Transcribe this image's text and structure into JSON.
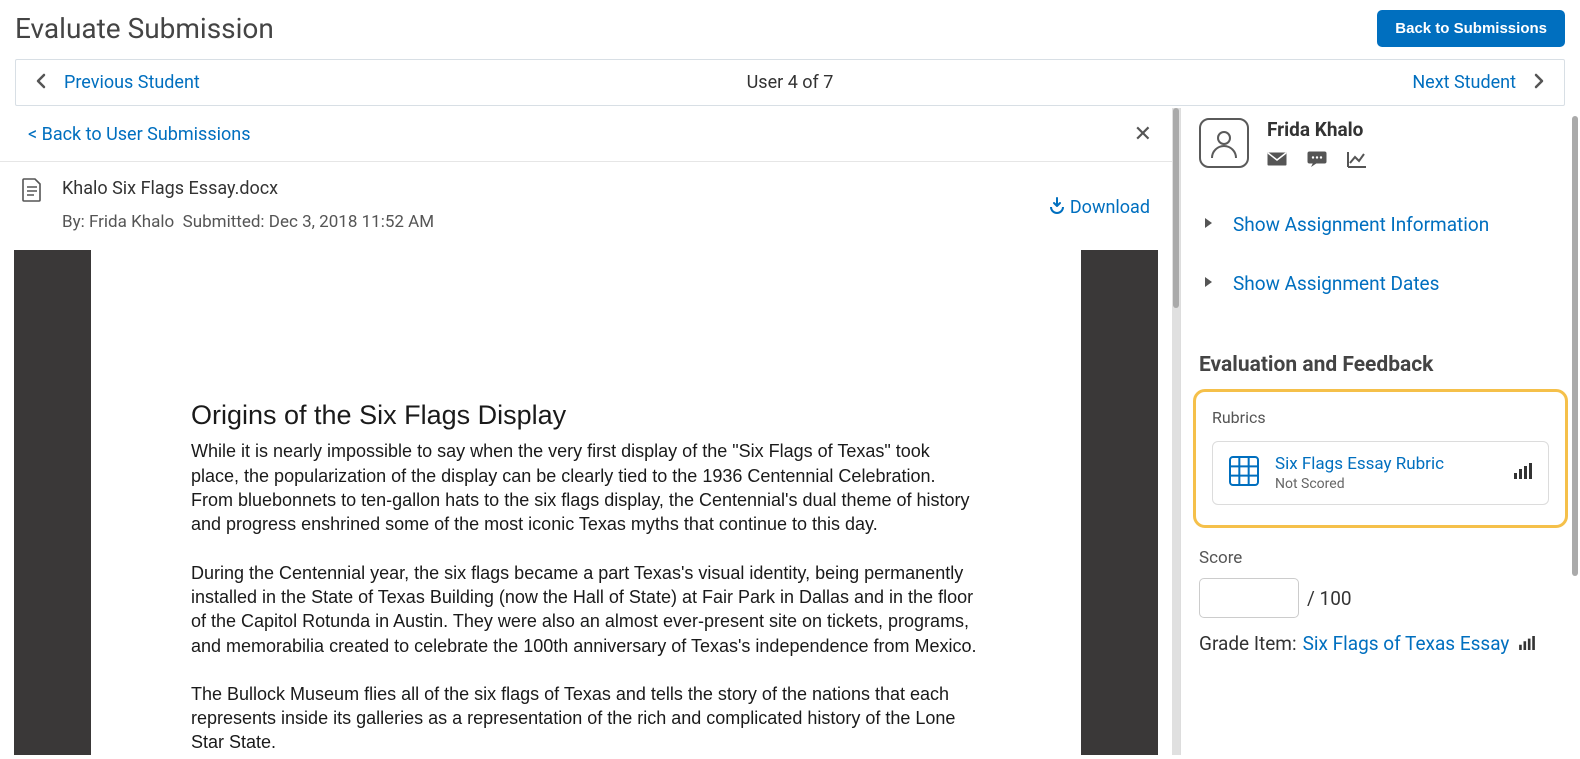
{
  "header": {
    "title": "Evaluate Submission",
    "back_button": "Back to Submissions"
  },
  "nav": {
    "prev": "Previous Student",
    "position": "User 4 of 7",
    "next": "Next Student"
  },
  "back_link": "< Back to User Submissions",
  "file": {
    "name": "Khalo Six Flags Essay.docx",
    "by_label": "By:",
    "author": "Frida Khalo",
    "submitted_label": "Submitted:",
    "submitted_at": "Dec 3, 2018 11:52 AM",
    "download": "Download"
  },
  "document": {
    "heading": "Origins of the Six Flags Display",
    "p1": "While it is nearly impossible to say when the very first display of the \"Six Flags of Texas\" took place, the popularization of the display can be clearly tied to the 1936 Centennial Celebration. From bluebonnets to ten-gallon hats to the six flags display, the Centennial's dual theme of history and progress enshrined some of the most iconic Texas myths that continue to this day.",
    "p2": "During the Centennial year, the six flags became a part Texas's visual identity, being permanently installed in the State of Texas Building (now the Hall of State) at Fair Park in Dallas and in the floor of the Capitol Rotunda in Austin. They were also an almost ever-present site on tickets, programs, and memorabilia created to celebrate the 100th anniversary of Texas's independence from Mexico.",
    "p3": "The Bullock Museum flies all of the six flags of Texas and tells the story of the nations that each represents inside its galleries as a representation of the rich and complicated history of the Lone Star State."
  },
  "sidebar": {
    "student_name": "Frida Khalo",
    "show_info": "Show Assignment Information",
    "show_dates": "Show Assignment Dates",
    "eval_heading": "Evaluation and Feedback",
    "rubrics_label": "Rubrics",
    "rubric_name": "Six Flags Essay Rubric",
    "rubric_status": "Not Scored",
    "score_label": "Score",
    "score_max": "/ 100",
    "grade_item_label": "Grade Item:",
    "grade_item_link": "Six Flags of Texas Essay"
  }
}
